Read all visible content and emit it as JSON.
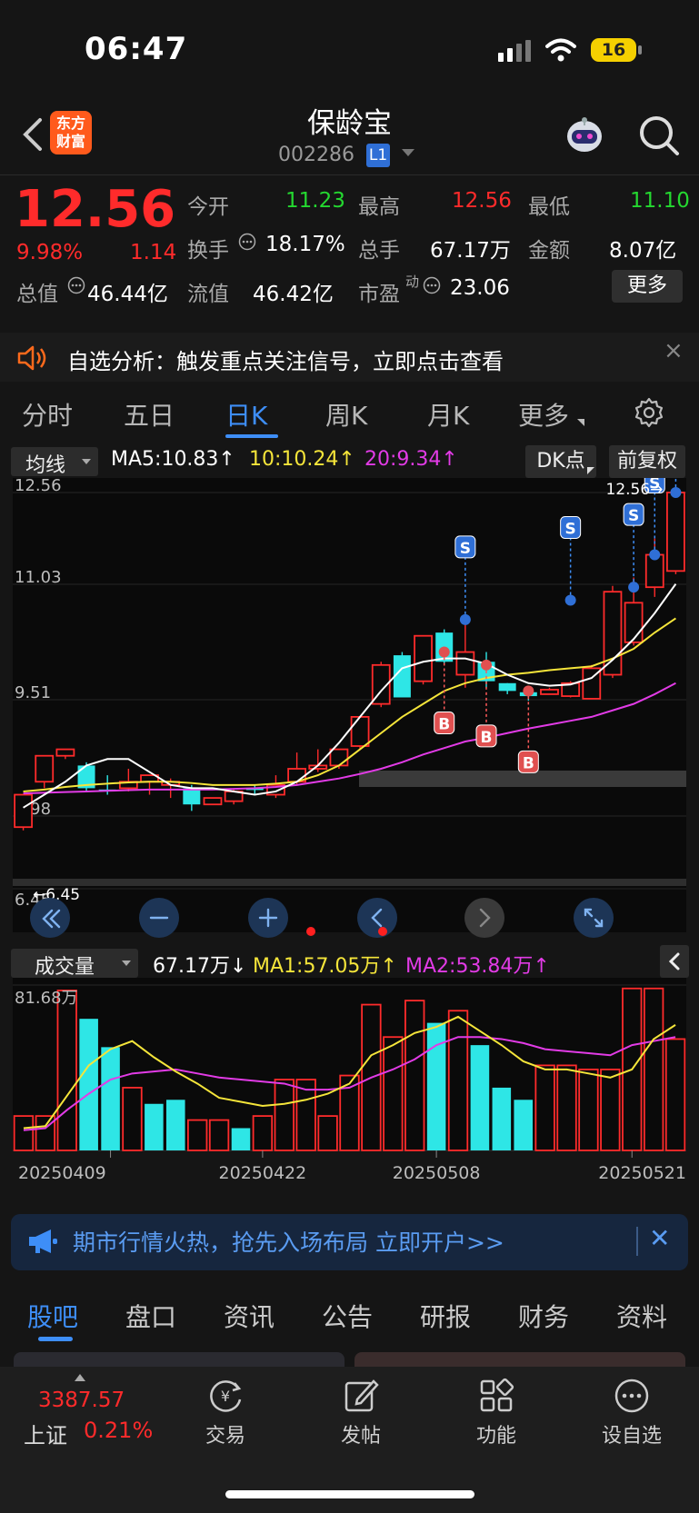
{
  "status_bar": {
    "time": "06:47",
    "battery": "16"
  },
  "header": {
    "logo_text_1": "东方",
    "logo_text_2": "财富",
    "stock_name": "保龄宝",
    "stock_code": "002286",
    "level_badge": "L1"
  },
  "quote": {
    "last_price": "12.56",
    "change_pct": "9.98%",
    "change": "1.14",
    "rows": [
      [
        {
          "label": "今开",
          "value": "11.23",
          "color": "green"
        },
        {
          "label": "最高",
          "value": "12.56",
          "color": "red"
        },
        {
          "label": "最低",
          "value": "11.10",
          "color": "green"
        }
      ],
      [
        {
          "label": "换手",
          "value": "18.17%",
          "color": "white"
        },
        {
          "label": "总手",
          "value": "67.17万",
          "color": "white"
        },
        {
          "label": "金额",
          "value": "8.07亿",
          "color": "white"
        }
      ],
      [
        {
          "label": "总值",
          "value": "46.44亿",
          "color": "white"
        },
        {
          "label": "流值",
          "value": "46.42亿",
          "color": "white"
        },
        {
          "label": "市盈",
          "label_sup": "动",
          "value": "23.06",
          "color": "white"
        }
      ]
    ],
    "more_label": "更多"
  },
  "announcement": {
    "text": "自选分析：触发重点关注信号，立即点击查看",
    "close": "×"
  },
  "period_tabs": [
    "分时",
    "五日",
    "日K",
    "周K",
    "月K",
    "更多"
  ],
  "ma_legend": {
    "selector": "均线",
    "ma5": "MA5:10.83",
    "ma10": "10:10.24",
    "ma20": "20:9.34",
    "colors": {
      "ma5": "#ffffff",
      "ma10": "#f5e53a",
      "ma20": "#e23be6"
    }
  },
  "dk_button": "DK点",
  "adj_button": "前复权",
  "chart_data": [
    {
      "type": "candlestick",
      "y_ticks": [
        "12.56",
        "11.03",
        "9.51",
        "7.98",
        "6.45"
      ],
      "ylim": [
        6.45,
        12.56
      ],
      "max_label": "12.56",
      "min_label": "6.45",
      "candles": [
        {
          "o": 7.4,
          "c": 7.9,
          "h": 7.9,
          "l": 7.35,
          "d": "red"
        },
        {
          "o": 8.1,
          "c": 8.5,
          "h": 8.5,
          "l": 8.0,
          "d": "red"
        },
        {
          "o": 8.5,
          "c": 8.6,
          "h": 8.6,
          "l": 8.45,
          "d": "red"
        },
        {
          "o": 8.35,
          "c": 8.0,
          "h": 8.4,
          "l": 7.95,
          "d": "green"
        },
        {
          "o": 7.98,
          "c": 7.98,
          "h": 8.2,
          "l": 7.9,
          "d": "green"
        },
        {
          "o": 8.0,
          "c": 8.1,
          "h": 8.3,
          "l": 7.95,
          "d": "red"
        },
        {
          "o": 8.1,
          "c": 8.2,
          "h": 8.2,
          "l": 7.9,
          "d": "red"
        },
        {
          "o": 8.05,
          "c": 8.1,
          "h": 8.15,
          "l": 7.85,
          "d": "red"
        },
        {
          "o": 8.0,
          "c": 7.75,
          "h": 8.05,
          "l": 7.65,
          "d": "green"
        },
        {
          "o": 7.75,
          "c": 7.85,
          "h": 7.85,
          "l": 7.75,
          "d": "red"
        },
        {
          "o": 7.8,
          "c": 7.95,
          "h": 8.0,
          "l": 7.75,
          "d": "red"
        },
        {
          "o": 7.98,
          "c": 8.0,
          "h": 8.05,
          "l": 7.9,
          "d": "green"
        },
        {
          "o": 7.9,
          "c": 8.05,
          "h": 8.2,
          "l": 7.85,
          "d": "red"
        },
        {
          "o": 8.1,
          "c": 8.3,
          "h": 8.55,
          "l": 8.05,
          "d": "red"
        },
        {
          "o": 8.3,
          "c": 8.35,
          "h": 8.6,
          "l": 8.25,
          "d": "red"
        },
        {
          "o": 8.35,
          "c": 8.6,
          "h": 8.6,
          "l": 8.3,
          "d": "red"
        },
        {
          "o": 8.65,
          "c": 9.1,
          "h": 9.1,
          "l": 8.6,
          "d": "red"
        },
        {
          "o": 9.3,
          "c": 9.9,
          "h": 9.95,
          "l": 9.25,
          "d": "red"
        },
        {
          "o": 9.4,
          "c": 10.05,
          "h": 10.1,
          "l": 9.4,
          "d": "green"
        },
        {
          "o": 9.65,
          "c": 10.35,
          "h": 10.35,
          "l": 9.6,
          "d": "red"
        },
        {
          "o": 10.4,
          "c": 9.95,
          "h": 10.45,
          "l": 9.9,
          "d": "green"
        },
        {
          "o": 9.75,
          "c": 10.1,
          "h": 10.65,
          "l": 9.55,
          "d": "red"
        },
        {
          "o": 9.95,
          "c": 9.65,
          "h": 10.1,
          "l": 9.55,
          "d": "green"
        },
        {
          "o": 9.62,
          "c": 9.5,
          "h": 9.62,
          "l": 9.45,
          "d": "green"
        },
        {
          "o": 9.48,
          "c": 9.42,
          "h": 9.52,
          "l": 9.35,
          "d": "green"
        },
        {
          "o": 9.45,
          "c": 9.52,
          "h": 9.55,
          "l": 9.45,
          "d": "red"
        },
        {
          "o": 9.42,
          "c": 9.62,
          "h": 9.65,
          "l": 9.4,
          "d": "red"
        },
        {
          "o": 9.38,
          "c": 9.85,
          "h": 9.9,
          "l": 9.38,
          "d": "red"
        },
        {
          "o": 9.75,
          "c": 11.03,
          "h": 11.12,
          "l": 9.7,
          "d": "red"
        },
        {
          "o": 10.25,
          "c": 10.86,
          "h": 11.25,
          "l": 10.2,
          "d": "red"
        },
        {
          "o": 11.1,
          "c": 11.6,
          "h": 11.85,
          "l": 10.95,
          "d": "red"
        },
        {
          "o": 11.35,
          "c": 12.56,
          "h": 12.56,
          "l": 11.3,
          "d": "red"
        }
      ],
      "ma5": [
        7.7,
        7.9,
        8.1,
        8.35,
        8.45,
        8.45,
        8.25,
        8.05,
        8.0,
        8.0,
        7.95,
        7.9,
        7.95,
        8.1,
        8.35,
        8.7,
        9.1,
        9.5,
        9.85,
        9.95,
        10.0,
        10.0,
        9.92,
        9.75,
        9.62,
        9.58,
        9.6,
        9.7,
        9.98,
        10.3,
        10.7,
        11.15
      ],
      "ma10": [
        7.95,
        7.98,
        8.02,
        8.05,
        8.07,
        8.09,
        8.1,
        8.1,
        8.08,
        8.05,
        8.05,
        8.05,
        8.07,
        8.1,
        8.2,
        8.35,
        8.6,
        8.85,
        9.1,
        9.3,
        9.5,
        9.62,
        9.7,
        9.75,
        9.78,
        9.82,
        9.85,
        9.88,
        10.0,
        10.15,
        10.4,
        10.62
      ],
      "ma20": [
        7.92,
        7.93,
        7.94,
        7.95,
        7.96,
        7.97,
        7.98,
        7.98,
        7.98,
        7.98,
        7.99,
        8.0,
        8.02,
        8.05,
        8.1,
        8.15,
        8.22,
        8.3,
        8.4,
        8.52,
        8.62,
        8.72,
        8.78,
        8.85,
        8.92,
        8.98,
        9.04,
        9.1,
        9.2,
        9.3,
        9.45,
        9.62
      ],
      "signals": [
        {
          "i": 21,
          "type": "S",
          "level": 10.6
        },
        {
          "i": 29,
          "type": "S",
          "level": 11.1
        },
        {
          "i": 30,
          "type": "S",
          "level": 11.6
        },
        {
          "i": 31,
          "type": "S",
          "level": 12.56
        },
        {
          "i": 26,
          "type": "S",
          "level": 10.9
        },
        {
          "i": 20,
          "type": "B",
          "level": 10.1
        },
        {
          "i": 22,
          "type": "B",
          "level": 9.9
        },
        {
          "i": 24,
          "type": "B",
          "level": 9.5
        }
      ],
      "signal_labels": {
        "sell": "S",
        "buy": "B"
      },
      "controls": [
        "pan-left",
        "zoom-out",
        "zoom-in",
        "step-left",
        "step-right",
        "fullscreen"
      ]
    },
    {
      "type": "bar",
      "title": "成交量",
      "last": "67.17万",
      "ma1": "MA1:57.05万",
      "ma2": "MA2:53.84万",
      "y_top_label": "81.68万",
      "ylim": [
        0,
        81.68
      ],
      "unit": "万",
      "x_labels": [
        "20250409",
        "20250422",
        "20250508",
        "20250521"
      ],
      "values": [
        17,
        17,
        79,
        65,
        51,
        31,
        23,
        25,
        15,
        15,
        11,
        17,
        35,
        35,
        17,
        37,
        72,
        56,
        74,
        63,
        69,
        52,
        31,
        25,
        42,
        42,
        40,
        40,
        80,
        80,
        55
      ],
      "directions": [
        "red",
        "red",
        "red",
        "green",
        "green",
        "red",
        "green",
        "green",
        "red",
        "red",
        "green",
        "red",
        "red",
        "red",
        "red",
        "red",
        "red",
        "red",
        "red",
        "green",
        "red",
        "green",
        "green",
        "green",
        "red",
        "red",
        "red",
        "red",
        "red",
        "red",
        "red"
      ],
      "ma1_series": [
        11,
        12,
        27,
        42,
        50,
        54,
        46,
        39,
        33,
        26,
        24,
        22,
        23,
        25,
        28,
        33,
        47,
        52,
        58,
        61,
        66,
        59,
        52,
        44,
        40,
        40,
        38,
        36,
        40,
        55,
        62
      ],
      "ma2_series": [
        10,
        11,
        20,
        28,
        35,
        38,
        39,
        40,
        38,
        36,
        35,
        34,
        33,
        30,
        30,
        31,
        36,
        40,
        45,
        52,
        56,
        56,
        55,
        53,
        50,
        49,
        48,
        47,
        52,
        54,
        56
      ]
    }
  ],
  "promo": {
    "text": "期市行情火热，抢先入场布局 立即开户>>"
  },
  "content_tabs": [
    "股吧",
    "盘口",
    "资讯",
    "公告",
    "研报",
    "财务",
    "资料"
  ],
  "bottom_nav": {
    "index_value": "3387.57",
    "index_name": "上证",
    "index_pct": "0.21%",
    "items": [
      "交易",
      "发帖",
      "功能",
      "设自选"
    ]
  }
}
